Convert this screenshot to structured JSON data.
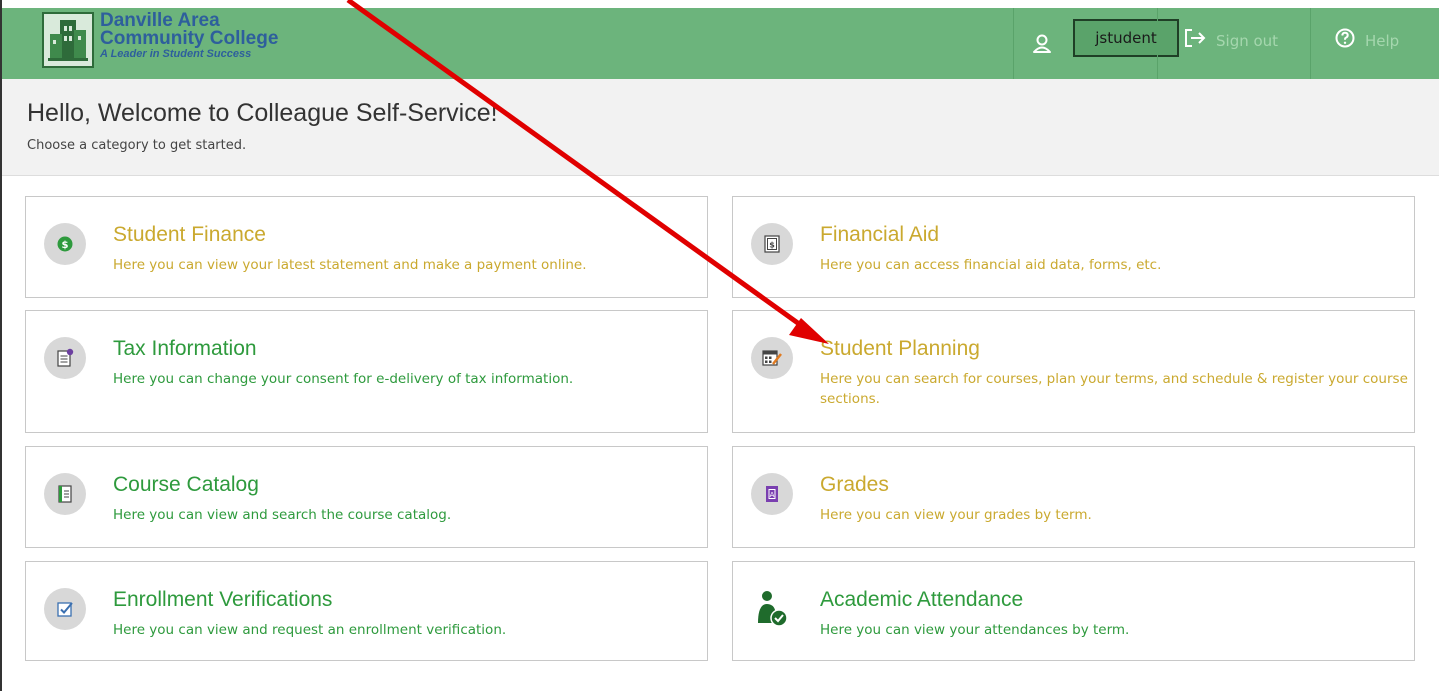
{
  "header": {
    "logo": {
      "line1": "Danville Area",
      "line2": "Community College",
      "tagline": "A Leader in Student Success"
    },
    "username": "jstudent",
    "sign_out": "Sign out",
    "help": "Help",
    "icons": {
      "user": "user-icon",
      "sign_out": "sign-out-icon",
      "help": "help-icon"
    }
  },
  "welcome": {
    "title": "Hello, Welcome to Colleague Self-Service!",
    "subtitle": "Choose a category to get started."
  },
  "cards": [
    {
      "title": "Student Finance",
      "description": "Here you can view your latest statement and make a payment online.",
      "icon": "dollar-icon"
    },
    {
      "title": "Financial Aid",
      "description": "Here you can access financial aid data, forms, etc.",
      "icon": "money-document-icon"
    },
    {
      "title": "Tax Information",
      "description": "Here you can change your consent for e-delivery of tax information.",
      "icon": "tax-document-icon"
    },
    {
      "title": "Student Planning",
      "description": "Here you can search for courses, plan your terms, and schedule & register your course sections.",
      "icon": "calendar-icon"
    },
    {
      "title": "Course Catalog",
      "description": "Here you can view and search the course catalog.",
      "icon": "catalog-icon"
    },
    {
      "title": "Grades",
      "description": "Here you can view your grades by term.",
      "icon": "grades-icon"
    },
    {
      "title": "Enrollment Verifications",
      "description": "Here you can view and request an enrollment verification.",
      "icon": "verification-icon"
    },
    {
      "title": "Academic Attendance",
      "description": "Here you can view your attendances by term.",
      "icon": "attendance-icon"
    }
  ],
  "colors": {
    "header_bg": "#6cb47c",
    "title_gold": "#caa92f",
    "title_green": "#2e9a3d",
    "annotation_arrow": "#e00000"
  }
}
